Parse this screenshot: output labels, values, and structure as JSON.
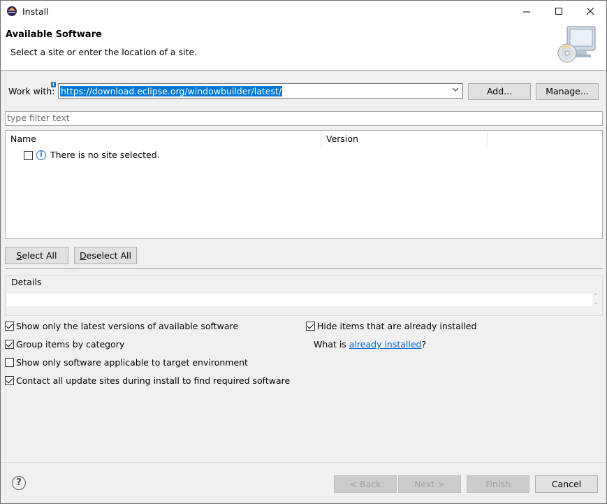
{
  "window": {
    "title": "Install",
    "controls": [
      "minimize",
      "maximize",
      "close"
    ]
  },
  "header": {
    "title": "Available Software",
    "description": "Select a site or enter the location of a site."
  },
  "work_with": {
    "label": "Work with:",
    "value": "https://download.eclipse.org/windowbuilder/latest/",
    "add_label": "Add...",
    "manage_label": "Manage..."
  },
  "filter": {
    "placeholder": "type filter text"
  },
  "table": {
    "columns": [
      "Name",
      "Version"
    ],
    "rows": [
      {
        "name": "There is no site selected.",
        "version": "",
        "checked": false
      }
    ]
  },
  "selection_buttons": {
    "select_all": "Select All",
    "deselect_all": "Deselect All"
  },
  "details": {
    "label": "Details",
    "text": ""
  },
  "options": {
    "latest_versions": {
      "label": "Show only the latest versions of available software",
      "checked": true
    },
    "group_by_category": {
      "label": "Group items by category",
      "checked": true
    },
    "target_env": {
      "label": "Show only software applicable to target environment",
      "checked": false
    },
    "contact_sites": {
      "label": "Contact all update sites during install to find required software",
      "checked": true
    },
    "hide_installed": {
      "label": "Hide items that are already installed",
      "checked": true
    },
    "what_is_prefix": "What is ",
    "what_is_link": "already installed",
    "what_is_suffix": "?"
  },
  "footer": {
    "back": "< Back",
    "next": "Next >",
    "finish": "Finish",
    "cancel": "Cancel"
  },
  "icons": {
    "app": "eclipse-icon",
    "header_image": "software-install-icon",
    "help": "help-icon",
    "info": "info-icon"
  },
  "colors": {
    "selection": "#0078d7",
    "link": "#0066cc",
    "dialog_bg": "#f0f0f0"
  }
}
